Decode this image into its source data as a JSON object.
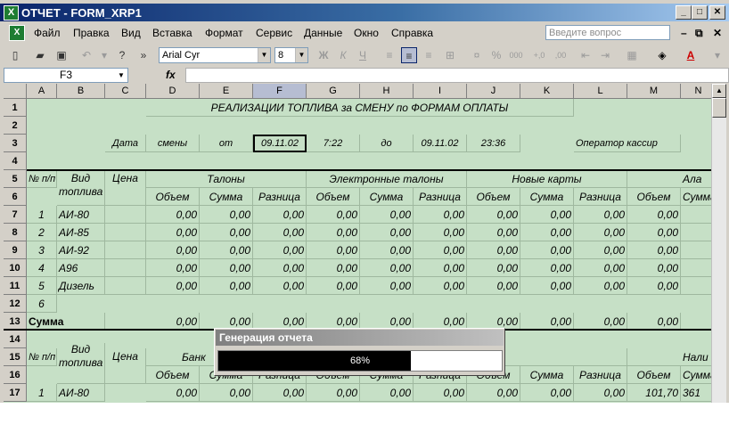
{
  "window": {
    "title": "ОТЧЕТ  -  FORM_XRP1",
    "app_icon": "excel-icon",
    "controls": [
      "_",
      "□",
      "✕"
    ]
  },
  "menu": {
    "items": [
      "Файл",
      "Правка",
      "Вид",
      "Вставка",
      "Формат",
      "Сервис",
      "Данные",
      "Окно",
      "Справка"
    ],
    "ask_placeholder": "Введите вопрос",
    "mdi_controls": [
      "–",
      "⧉",
      "✕"
    ]
  },
  "toolbar": {
    "font_name": "Arial Cyr",
    "font_size": "8",
    "bold": "Ж",
    "italic": "К",
    "underline": "Ч",
    "percent": "%",
    "thousands": "000",
    "inc_decimal": "+,0",
    "dec_decimal": ",00",
    "fill_color": "#ffff00",
    "font_color": "#ff0000"
  },
  "formula_bar": {
    "name_box": "F3",
    "fx": "fx",
    "value": ""
  },
  "columns": [
    "A",
    "B",
    "C",
    "D",
    "E",
    "F",
    "G",
    "H",
    "I",
    "J",
    "K",
    "L",
    "M",
    "N"
  ],
  "selected_column": "F",
  "rows": [
    "1",
    "2",
    "3",
    "4",
    "5",
    "6",
    "7",
    "8",
    "9",
    "10",
    "11",
    "12",
    "13",
    "14",
    "15",
    "16",
    "17"
  ],
  "sheet": {
    "title": "РЕАЛИЗАЦИИ ТОПЛИВА за СМЕНУ по ФОРМАМ ОПЛАТЫ",
    "meta": {
      "date_label": "Дата",
      "shift_label": "смены",
      "from_label": "от",
      "from_date": "09.11.02",
      "from_time": "7:22",
      "to_label": "до",
      "to_date": "09.11.02",
      "to_time": "23:36",
      "operator_label": "Оператор кассир"
    },
    "hdr": {
      "num": "№ п/п",
      "fuel_type": "Вид топлива",
      "price": "Цена",
      "coupons": "Талоны",
      "electronic": "Электронные талоны",
      "new_cards": "Новые карты",
      "alpha": "Ала",
      "volume": "Объем",
      "sum": "Сумма",
      "diff": "Разница",
      "bank": "Банк",
      "cash": "Нали"
    },
    "data_rows": [
      {
        "n": "1",
        "fuel": "АИ-80"
      },
      {
        "n": "2",
        "fuel": "АИ-85"
      },
      {
        "n": "3",
        "fuel": "АИ-92"
      },
      {
        "n": "4",
        "fuel": "А96"
      },
      {
        "n": "5",
        "fuel": "Дизель"
      }
    ],
    "row6_num": "6",
    "zero": "0,00",
    "total_label": "Сумма",
    "row17": {
      "n": "1",
      "fuel": "АИ-80",
      "volume": "101,70",
      "sum": "361"
    }
  },
  "progress": {
    "title": "Генерация отчета",
    "percent": 68,
    "label": "68%"
  }
}
